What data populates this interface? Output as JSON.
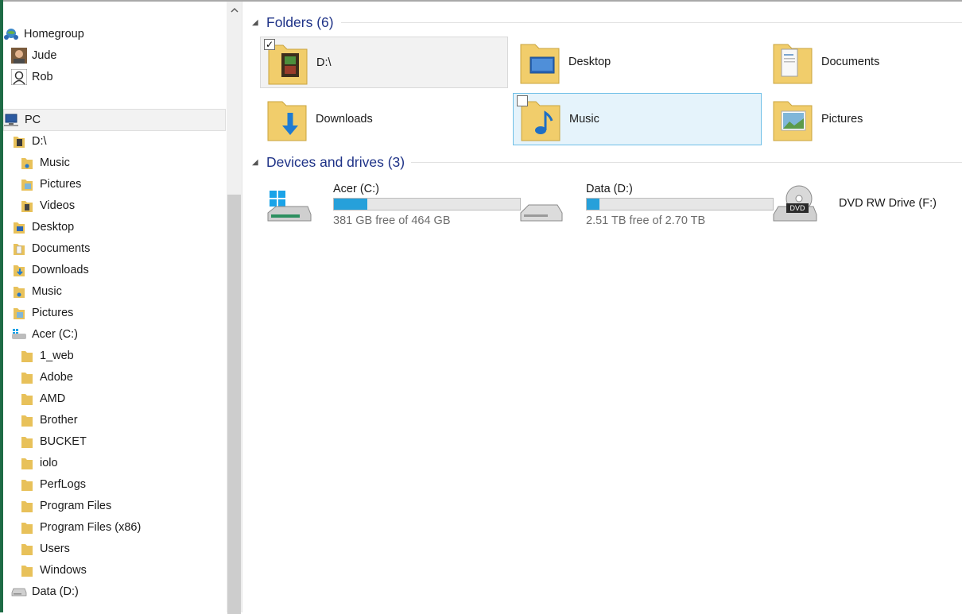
{
  "nav": {
    "homegroup": "Homegroup",
    "users": [
      "Jude",
      "Rob"
    ],
    "pc": "PC",
    "d_drive": "D:\\",
    "d_children": [
      "Music",
      "Pictures",
      "Videos"
    ],
    "libraries": [
      "Desktop",
      "Documents",
      "Downloads",
      "Music",
      "Pictures"
    ],
    "c_drive": "Acer (C:)",
    "c_children": [
      "1_web",
      "Adobe",
      "AMD",
      "Brother",
      "BUCKET",
      "iolo",
      "PerfLogs",
      "Program Files",
      "Program Files (x86)",
      "Users",
      "Windows"
    ],
    "data_drive": "Data (D:)"
  },
  "content": {
    "folders_header": "Folders (6)",
    "folders": [
      {
        "name": "D:\\",
        "icon": "video-folder-icon",
        "selected": "gray",
        "checked": true
      },
      {
        "name": "Desktop",
        "icon": "desktop-folder-icon"
      },
      {
        "name": "Documents",
        "icon": "documents-folder-icon"
      },
      {
        "name": "Downloads",
        "icon": "downloads-folder-icon"
      },
      {
        "name": "Music",
        "icon": "music-folder-icon",
        "selected": "blue",
        "checked": false
      },
      {
        "name": "Pictures",
        "icon": "pictures-folder-icon"
      }
    ],
    "devices_header": "Devices and drives (3)",
    "drives": [
      {
        "name": "Acer (C:)",
        "free": "381 GB free of 464 GB",
        "used_fraction": 0.179,
        "icon": "windows-drive-icon"
      },
      {
        "name": "Data (D:)",
        "free": "2.51 TB free of 2.70 TB",
        "used_fraction": 0.07,
        "icon": "hard-drive-icon"
      },
      {
        "name": "DVD RW Drive (F:)",
        "icon": "dvd-drive-icon"
      }
    ]
  },
  "colors": {
    "header": "#1e3287",
    "bar_fill": "#26a0da",
    "selection_blue": "#e5f3fb",
    "selection_border": "#70c0e7"
  },
  "icons": {
    "dvd_label": "DVD"
  }
}
